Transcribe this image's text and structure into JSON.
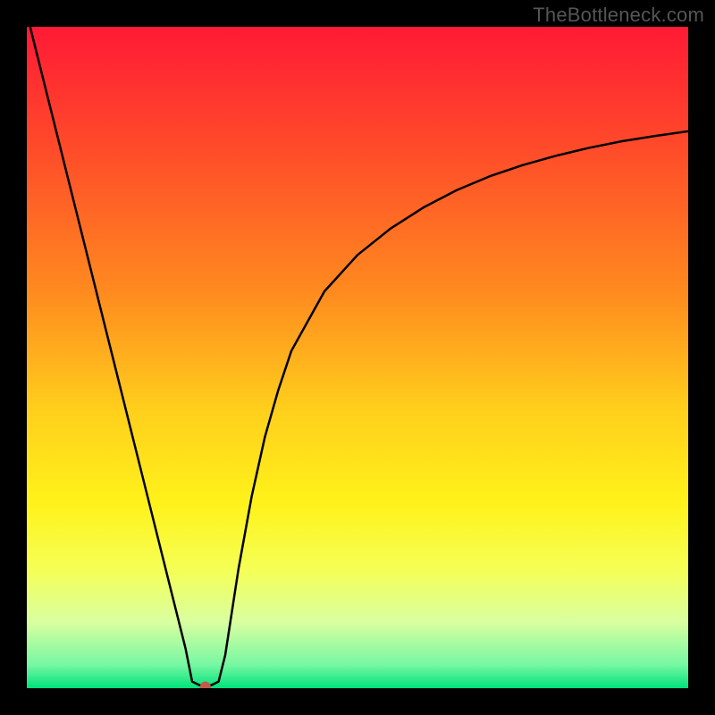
{
  "watermark": "TheBottleneck.com",
  "chart_data": {
    "type": "line",
    "title": "",
    "xlabel": "",
    "ylabel": "",
    "xlim": [
      0,
      100
    ],
    "ylim": [
      0,
      100
    ],
    "grid": false,
    "series": [
      {
        "name": "bottleneck-curve",
        "color": "#000000",
        "x": [
          0,
          2,
          4,
          6,
          8,
          10,
          12,
          14,
          16,
          18,
          20,
          22,
          24,
          25,
          26,
          27,
          28,
          29,
          30,
          32,
          34,
          36,
          38,
          40,
          45,
          50,
          55,
          60,
          65,
          70,
          75,
          80,
          85,
          90,
          95,
          100
        ],
        "y": [
          102,
          94,
          86,
          78,
          70,
          62,
          54,
          46,
          38,
          30,
          22,
          14,
          6,
          1,
          0.5,
          0.2,
          0.5,
          1,
          5,
          18,
          29,
          38,
          45,
          51,
          60,
          65.5,
          69.5,
          72.7,
          75.3,
          77.4,
          79.1,
          80.5,
          81.7,
          82.7,
          83.5,
          84.2
        ]
      }
    ],
    "marker": {
      "x": 27,
      "y": 0.2,
      "color": "#c25a4a",
      "radius": 6
    },
    "gradient_stops": [
      {
        "offset": 0.0,
        "color": "#ff1a35"
      },
      {
        "offset": 0.18,
        "color": "#ff4a2a"
      },
      {
        "offset": 0.4,
        "color": "#ff8a1f"
      },
      {
        "offset": 0.58,
        "color": "#ffcf1c"
      },
      {
        "offset": 0.72,
        "color": "#fff21a"
      },
      {
        "offset": 0.82,
        "color": "#f5ff55"
      },
      {
        "offset": 0.9,
        "color": "#d9ffa0"
      },
      {
        "offset": 0.965,
        "color": "#76f7a3"
      },
      {
        "offset": 1.0,
        "color": "#00e27a"
      }
    ]
  }
}
